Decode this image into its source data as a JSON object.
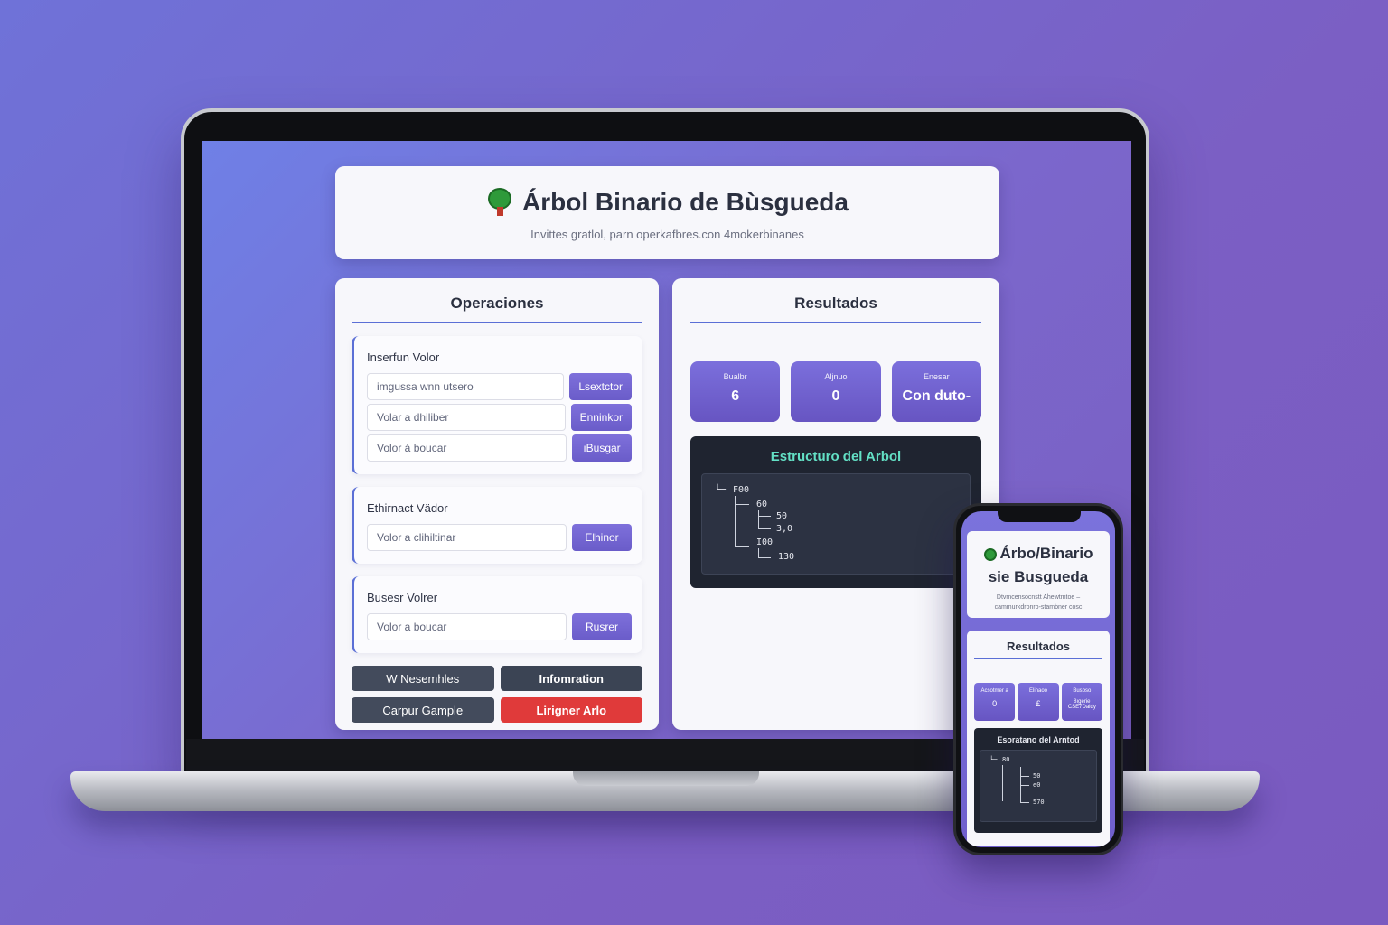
{
  "app": {
    "title": "Árbol Binario de Bùsgueda",
    "subtitle": "Invittes gratlol, parn operkafbres.con 4mokerbinanes",
    "icon": "tree-icon"
  },
  "operations": {
    "title": "Operaciones",
    "insert": {
      "label": "Inserfun Volor",
      "rows": [
        {
          "placeholder": "imgussa wnn utsero",
          "button": "Lsextctor"
        },
        {
          "placeholder": "Volar a dhiliber",
          "button": "Enninkor"
        },
        {
          "placeholder": "Volor á boucar",
          "button": "ıBusgar"
        }
      ]
    },
    "delete": {
      "label": "Ethirnact Vädor",
      "placeholder": "Volor a clihiltinar",
      "button": "Elhinor"
    },
    "search": {
      "label": "Busesr Volrer",
      "placeholder": "Volor a boucar",
      "button": "Rusrer"
    },
    "actions": {
      "btn1": "W Nesemhles",
      "btn2": "Infomration",
      "btn3": "Carpur Gample",
      "btn4": "Lirigner Arlo"
    }
  },
  "results": {
    "title": "Resultados",
    "stats": [
      {
        "label": "Bualbr",
        "value": "6"
      },
      {
        "label": "Aljnuo",
        "value": "0"
      },
      {
        "label": "Enesar",
        "value": "Con duto-"
      }
    ],
    "structure": {
      "title": "Estructuro del Arbol",
      "nodes": {
        "root": "F00",
        "n1": "60",
        "n2": "50",
        "n3": "3,0",
        "n4": "I00",
        "n5": "130",
        "root_prefix": "└─"
      }
    }
  },
  "mobile": {
    "title_line1": "Árbo/Binario",
    "title_line2": "sie Busgueda",
    "sub_line1": "Dtvmcensocnstt Ahewtmtoe –",
    "sub_line2": "cammurkdronro-stambner cosc",
    "results_title": "Resultados",
    "stats": [
      {
        "label": "Acsotmer a",
        "value": "0"
      },
      {
        "label": "Elinaoo",
        "value": "£"
      },
      {
        "label": "Busbso",
        "value": "8ıgerie CSE7Daldy"
      }
    ],
    "structure_title": "Esoratano del Arntod",
    "nodes": {
      "root": "80",
      "n1": "50",
      "n2": "e0",
      "n3": "570"
    }
  },
  "colors": {
    "accent": "#5b6fd6",
    "button": "#6a5cc9",
    "danger": "#e03a3a",
    "tree_bg": "#1f2430",
    "tree_title": "#63e0c5"
  }
}
